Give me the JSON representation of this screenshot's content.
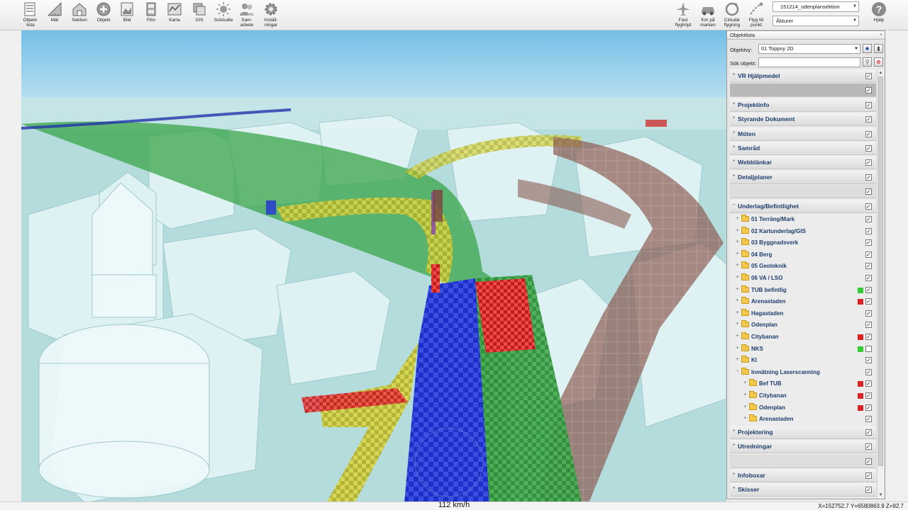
{
  "toolbar": {
    "left_buttons": [
      {
        "label": "Objekt-\nlista",
        "icon": "objektlista-icon"
      },
      {
        "label": "Mät",
        "icon": "ruler-icon"
      },
      {
        "label": "Sektion",
        "icon": "section-house-icon"
      },
      {
        "label": "Objekt",
        "icon": "add-object-icon"
      },
      {
        "label": "Bild",
        "icon": "image-icon"
      },
      {
        "label": "Film",
        "icon": "film-icon"
      },
      {
        "label": "Karta",
        "icon": "map-icon"
      },
      {
        "label": "GIS",
        "icon": "gis-layers-icon"
      },
      {
        "label": "Solstudie",
        "icon": "sun-icon"
      },
      {
        "label": "Sam-\narbete",
        "icon": "users-icon"
      },
      {
        "label": "Inställ-\nningar",
        "icon": "gear-icon"
      }
    ],
    "right_buttons": [
      {
        "label": "Fast\nflyghöjd",
        "icon": "airplane-icon"
      },
      {
        "label": "Kör på\nmarken",
        "icon": "car-icon"
      },
      {
        "label": "Cirkulär\nflygning",
        "icon": "circular-flight-icon"
      },
      {
        "label": "Flyg till\npunkt",
        "icon": "fly-to-point-icon"
      }
    ],
    "scene_select": "151214_odenplansektion",
    "action_select": "Åkturer",
    "help_label": "Hjälp"
  },
  "panel": {
    "title": "Objektlista",
    "objektvy_label": "Objektvy:",
    "objektvy_value": "01 Toppvy 2D",
    "search_label": "Sök objekt:",
    "search_value": ""
  },
  "tree": {
    "rows": [
      {
        "type": "header",
        "label": "VR Hjälpmedel",
        "checked": true,
        "expander": "+"
      },
      {
        "type": "blank-dark",
        "checked": true
      },
      {
        "type": "header",
        "label": "Projektinfo",
        "checked": true,
        "expander": "+"
      },
      {
        "type": "header",
        "label": "Styrande Dokument",
        "checked": true,
        "expander": "+"
      },
      {
        "type": "header",
        "label": "Möten",
        "checked": true,
        "expander": "+"
      },
      {
        "type": "header",
        "label": "Samråd",
        "checked": true,
        "expander": "+"
      },
      {
        "type": "header",
        "label": "Webblänkar",
        "checked": true,
        "expander": "+"
      },
      {
        "type": "header",
        "label": "Detaljplaner",
        "checked": true,
        "expander": "+"
      },
      {
        "type": "blank",
        "checked": true
      },
      {
        "type": "header",
        "label": "Underlag/Befintlighet",
        "checked": true,
        "expander": "−"
      },
      {
        "type": "sub",
        "level": 1,
        "label": "01 Terräng/Mark",
        "checked": true,
        "status": ""
      },
      {
        "type": "sub",
        "level": 1,
        "label": "02 Kartunderlag/GIS",
        "checked": true,
        "status": ""
      },
      {
        "type": "sub",
        "level": 1,
        "label": "03 Byggnadsverk",
        "checked": true,
        "status": ""
      },
      {
        "type": "sub",
        "level": 1,
        "label": "04 Berg",
        "checked": true,
        "status": ""
      },
      {
        "type": "sub",
        "level": 1,
        "label": "05 Geoteknik",
        "checked": true,
        "status": ""
      },
      {
        "type": "sub",
        "level": 1,
        "label": "06 VA / LSO",
        "checked": true,
        "status": ""
      },
      {
        "type": "sub",
        "level": 1,
        "label": "TUB befintlig",
        "checked": true,
        "status": "#33cc33"
      },
      {
        "type": "sub",
        "level": 1,
        "label": "Arenastaden",
        "checked": true,
        "status": "#dd2222"
      },
      {
        "type": "sub",
        "level": 1,
        "label": "Hagastaden",
        "checked": true,
        "status": ""
      },
      {
        "type": "sub",
        "level": 1,
        "label": "Odenplan",
        "checked": true,
        "status": ""
      },
      {
        "type": "sub",
        "level": 1,
        "label": "Citybanan",
        "checked": true,
        "status": "#dd2222"
      },
      {
        "type": "sub",
        "level": 1,
        "label": "NKS",
        "checked": false,
        "status": "#33cc33"
      },
      {
        "type": "sub",
        "level": 1,
        "label": "KI",
        "checked": true,
        "status": ""
      },
      {
        "type": "sub",
        "level": 1,
        "label": "Inmätning Laserscanning",
        "checked": true,
        "status": "",
        "expander": "−"
      },
      {
        "type": "sub",
        "level": 2,
        "label": "Bef TUB",
        "checked": true,
        "status": "#dd2222"
      },
      {
        "type": "sub",
        "level": 2,
        "label": "Citybanan",
        "checked": true,
        "status": "#dd2222"
      },
      {
        "type": "sub",
        "level": 2,
        "label": "Odenplan",
        "checked": true,
        "status": "#dd2222"
      },
      {
        "type": "sub",
        "level": 2,
        "label": "Arenastaden",
        "checked": true,
        "status": ""
      },
      {
        "type": "header",
        "label": "Projektering",
        "checked": true,
        "expander": "+"
      },
      {
        "type": "header",
        "label": "Utredningar",
        "checked": true,
        "expander": "+"
      },
      {
        "type": "blank",
        "checked": true
      },
      {
        "type": "header",
        "label": "Infoboxar",
        "checked": true,
        "expander": "+"
      },
      {
        "type": "header",
        "label": "Skisser",
        "checked": true,
        "expander": "+"
      }
    ]
  },
  "status": {
    "speed": "112 km/h",
    "coords": "X=152752.7  Y=6580863.9  Z=92.7"
  },
  "colors": {
    "sky_top": "#7ec3e6",
    "sky_bottom": "#cfe9f3",
    "ground": "#a9d3d3",
    "building": "#dff2f4",
    "tunnel_green": "#3aa64a",
    "tunnel_blue": "#2233cc",
    "tunnel_yellow": "#c9c23a",
    "tunnel_brown": "#8a5c52",
    "tunnel_red": "#d42a2a"
  }
}
